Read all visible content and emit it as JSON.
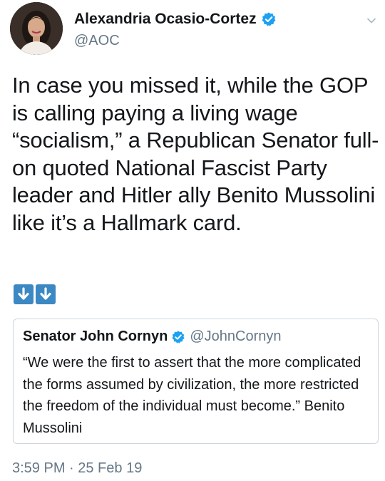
{
  "tweet": {
    "author_name": "Alexandria Ocasio-Cortez",
    "author_handle": "@AOC",
    "body": "In case you missed it, while the GOP is calling paying a living wage “socialism,” a Republican Senator full-on quoted National Fascist Party leader and Hitler ally Benito Mussolini like it’s a Hallmark card.",
    "emojis": [
      "down-arrow-emoji",
      "down-arrow-emoji"
    ],
    "timestamp": "3:59 PM · 25 Feb 19"
  },
  "quoted_tweet": {
    "author_name": "Senator John Cornyn",
    "author_handle": "@JohnCornyn",
    "body": "“We were the first to assert that the more complicated the forms assumed by civilization, the more restricted the freedom of the individual must become.” Benito Mussolini"
  },
  "colors": {
    "text": "#14171a",
    "secondary": "#657786",
    "verified_blue": "#1da1f2",
    "emoji_blue": "#3b88c3",
    "border": "#ccd6dd"
  },
  "icons": {
    "verified": "verified-badge-icon",
    "caret": "chevron-down-icon"
  }
}
